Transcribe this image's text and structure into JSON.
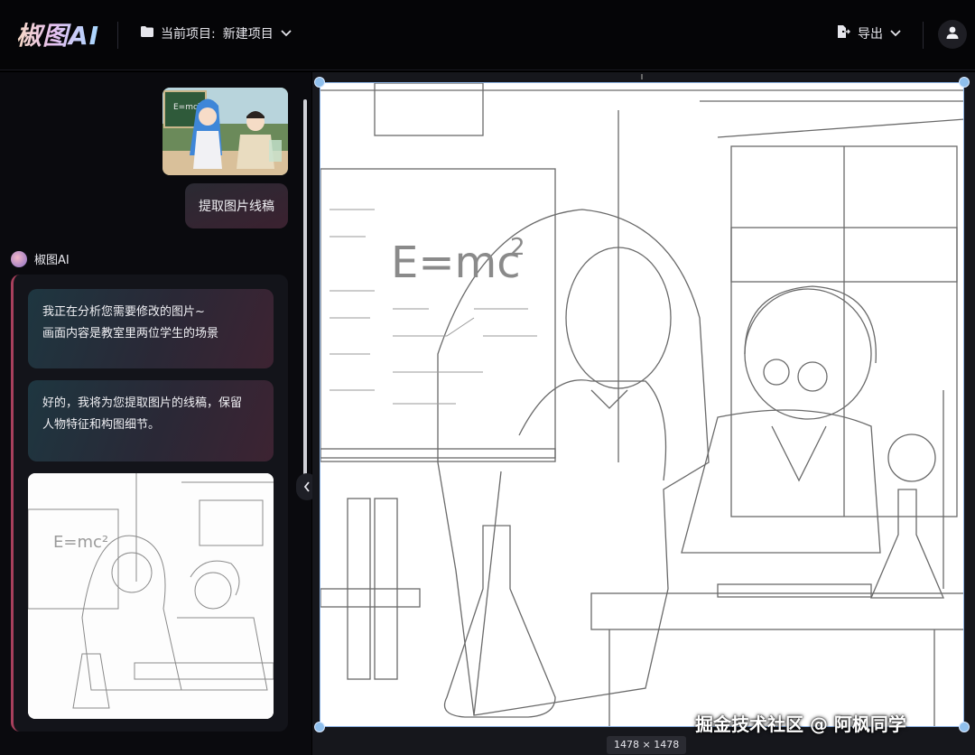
{
  "header": {
    "logo_text": "椒图AI",
    "project_label": "当前项目:",
    "project_name": "新建项目",
    "export_label": "导出"
  },
  "chat": {
    "user_message": "提取图片线稿",
    "assistant_name": "椒图AI",
    "assistant_msg1_line1": "我正在分析您需要修改的图片~",
    "assistant_msg1_line2": "画面内容是教室里两位学生的场景",
    "assistant_msg2_line1": "好的，我将为您提取图片的线稿，保留",
    "assistant_msg2_line2": "人物特征和构图细节。"
  },
  "canvas": {
    "size_label": "1478 × 1478",
    "board_formula": "E=mc",
    "board_exp": "2"
  },
  "watermark": "掘金技术社区 @ 阿枫同学",
  "colors": {
    "accent": "#a8405d",
    "handle": "#8fbfec",
    "background": "#000000"
  }
}
